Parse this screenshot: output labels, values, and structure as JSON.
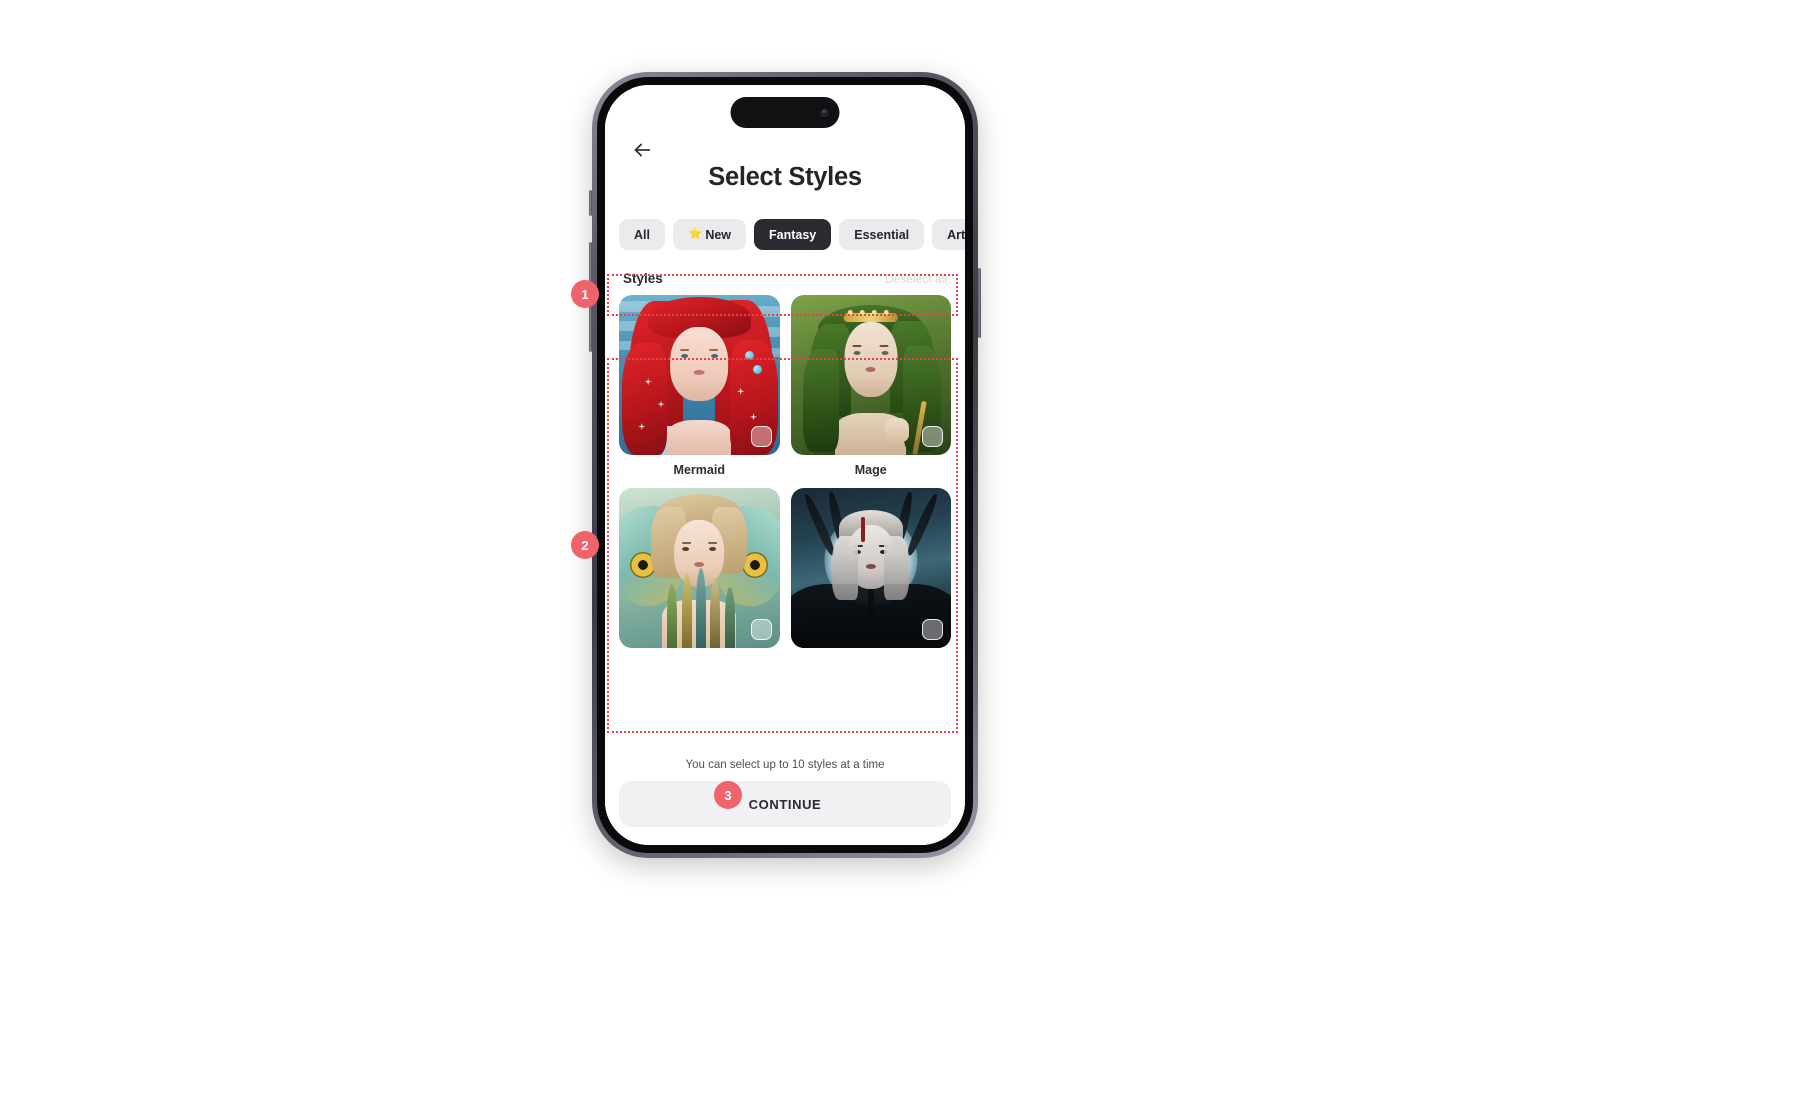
{
  "app": {
    "title": "Select Styles",
    "back_icon": "arrow-left-icon"
  },
  "filters": {
    "chips": [
      {
        "label": "All",
        "icon": "",
        "active": false
      },
      {
        "label": "New",
        "icon": "star-icon",
        "active": false
      },
      {
        "label": "Fantasy",
        "icon": "",
        "active": true
      },
      {
        "label": "Essential",
        "icon": "",
        "active": false
      },
      {
        "label": "Art",
        "icon": "",
        "active": false
      }
    ]
  },
  "styles_section": {
    "heading": "Styles",
    "deselect_all_label": "Deselect all",
    "cards": [
      {
        "label": "Mermaid",
        "art": "mermaid",
        "selected": false
      },
      {
        "label": "Mage",
        "art": "mage",
        "selected": false
      },
      {
        "label": "",
        "art": "fairy",
        "selected": false
      },
      {
        "label": "",
        "art": "dark-fae",
        "selected": false
      }
    ]
  },
  "footer": {
    "hint": "You can select up to 10 styles at a time",
    "continue_label": "CONTINUE"
  },
  "annotations": {
    "badges": [
      {
        "number": "1"
      },
      {
        "number": "2"
      },
      {
        "number": "3"
      }
    ],
    "accent_color": "#f0636b",
    "outline_color": "#e8414a"
  }
}
